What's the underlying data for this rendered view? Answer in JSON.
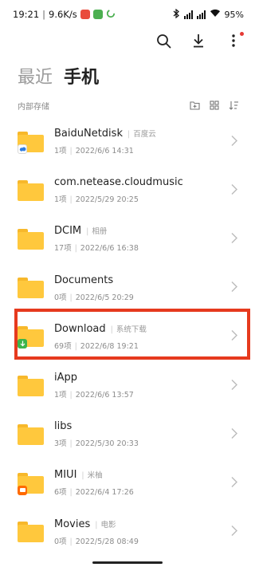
{
  "status_bar": {
    "time": "19:21",
    "speed": "9.6K/s",
    "battery": "95"
  },
  "colors": {
    "folder": "#ffc83d",
    "folder_tab": "#f7b82b",
    "highlight": "#e63a1e",
    "notification_dot": "#e53935"
  },
  "toolbar": {
    "icons": [
      "search-icon",
      "download-icon",
      "more-icon"
    ]
  },
  "tabs": [
    {
      "label": "最近",
      "active": false
    },
    {
      "label": "手机",
      "active": true
    }
  ],
  "section": {
    "title": "内部存储",
    "tools": [
      "new-folder-icon",
      "grid-view-icon",
      "sort-icon"
    ]
  },
  "files": [
    {
      "name": "BaiduNetdisk",
      "tag": "百度云",
      "count": "1项",
      "date": "2022/6/6 14:31",
      "badge": "baidu"
    },
    {
      "name": "com.netease.cloudmusic",
      "tag": "",
      "count": "1项",
      "date": "2022/5/29 20:25",
      "badge": ""
    },
    {
      "name": "DCIM",
      "tag": "相册",
      "count": "17项",
      "date": "2022/6/6 16:38",
      "badge": ""
    },
    {
      "name": "Documents",
      "tag": "",
      "count": "0项",
      "date": "2022/6/5 20:29",
      "badge": ""
    },
    {
      "name": "Download",
      "tag": "系统下载",
      "count": "69项",
      "date": "2022/6/8 19:21",
      "badge": "download"
    },
    {
      "name": "iApp",
      "tag": "",
      "count": "1项",
      "date": "2022/6/6 13:57",
      "badge": ""
    },
    {
      "name": "libs",
      "tag": "",
      "count": "3项",
      "date": "2022/5/30 20:33",
      "badge": ""
    },
    {
      "name": "MIUI",
      "tag": "米柚",
      "count": "6项",
      "date": "2022/6/4 17:26",
      "badge": "miui"
    },
    {
      "name": "Movies",
      "tag": "电影",
      "count": "0项",
      "date": "2022/5/28 08:49",
      "badge": ""
    }
  ]
}
